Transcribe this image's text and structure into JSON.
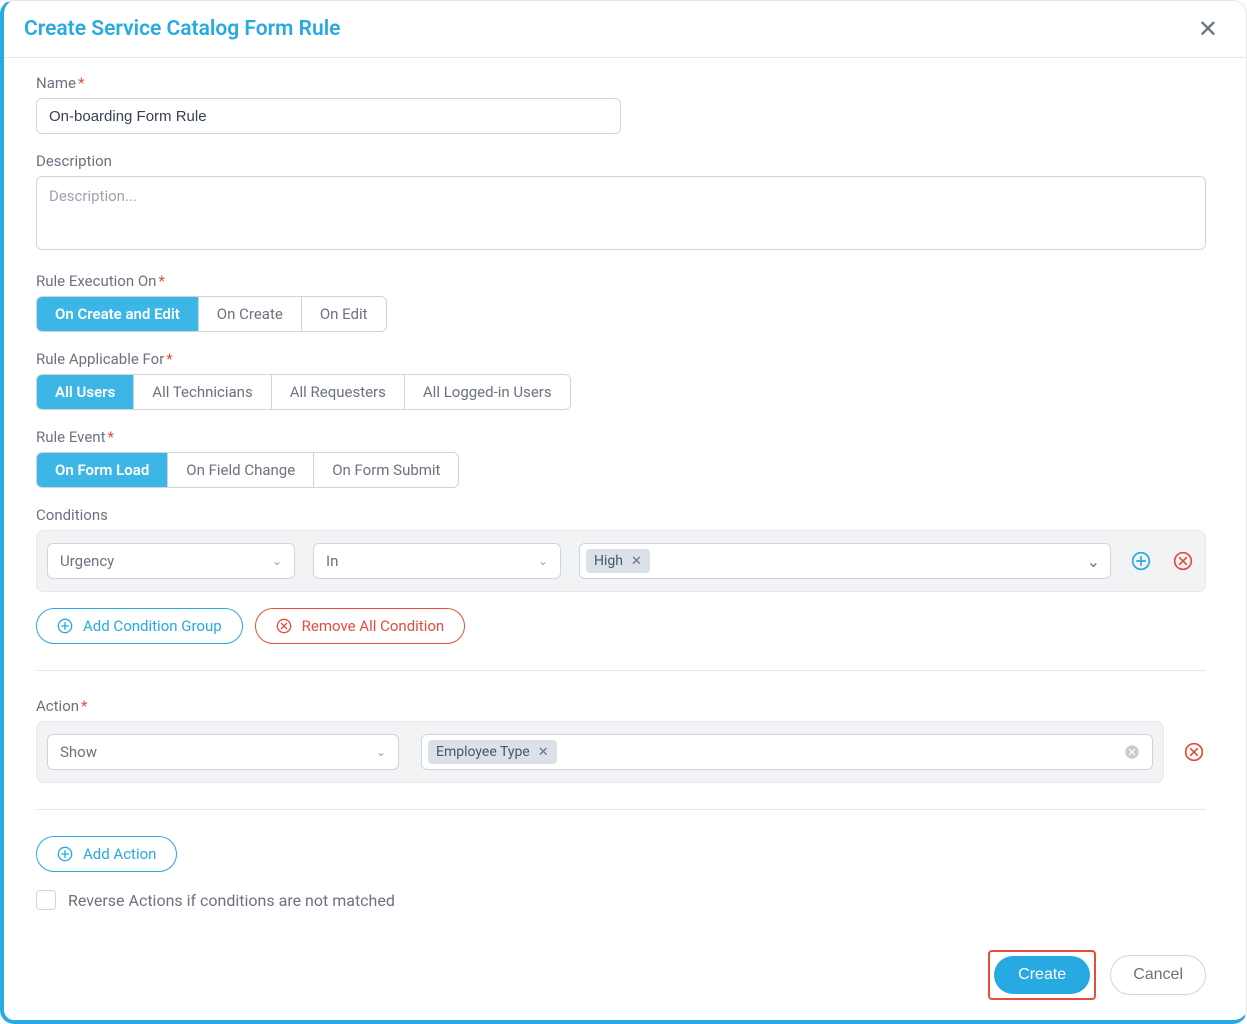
{
  "header": {
    "title": "Create Service Catalog Form Rule"
  },
  "fields": {
    "name_label": "Name",
    "name_value": "On-boarding Form Rule",
    "description_label": "Description",
    "description_placeholder": "Description...",
    "rule_exec_label": "Rule Execution On",
    "rule_exec_options": [
      "On Create and Edit",
      "On Create",
      "On Edit"
    ],
    "rule_applicable_label": "Rule Applicable For",
    "rule_applicable_options": [
      "All Users",
      "All Technicians",
      "All Requesters",
      "All Logged-in Users"
    ],
    "rule_event_label": "Rule Event",
    "rule_event_options": [
      "On Form Load",
      "On Field Change",
      "On Form Submit"
    ]
  },
  "conditions": {
    "label": "Conditions",
    "row": {
      "field": "Urgency",
      "operator": "In",
      "value": "High"
    },
    "add_group_label": "Add Condition Group",
    "remove_all_label": "Remove All Condition"
  },
  "action": {
    "label": "Action",
    "type": "Show",
    "target": "Employee Type",
    "add_action_label": "Add Action"
  },
  "reverse_label": "Reverse Actions if conditions are not matched",
  "footer": {
    "create_label": "Create",
    "cancel_label": "Cancel"
  }
}
